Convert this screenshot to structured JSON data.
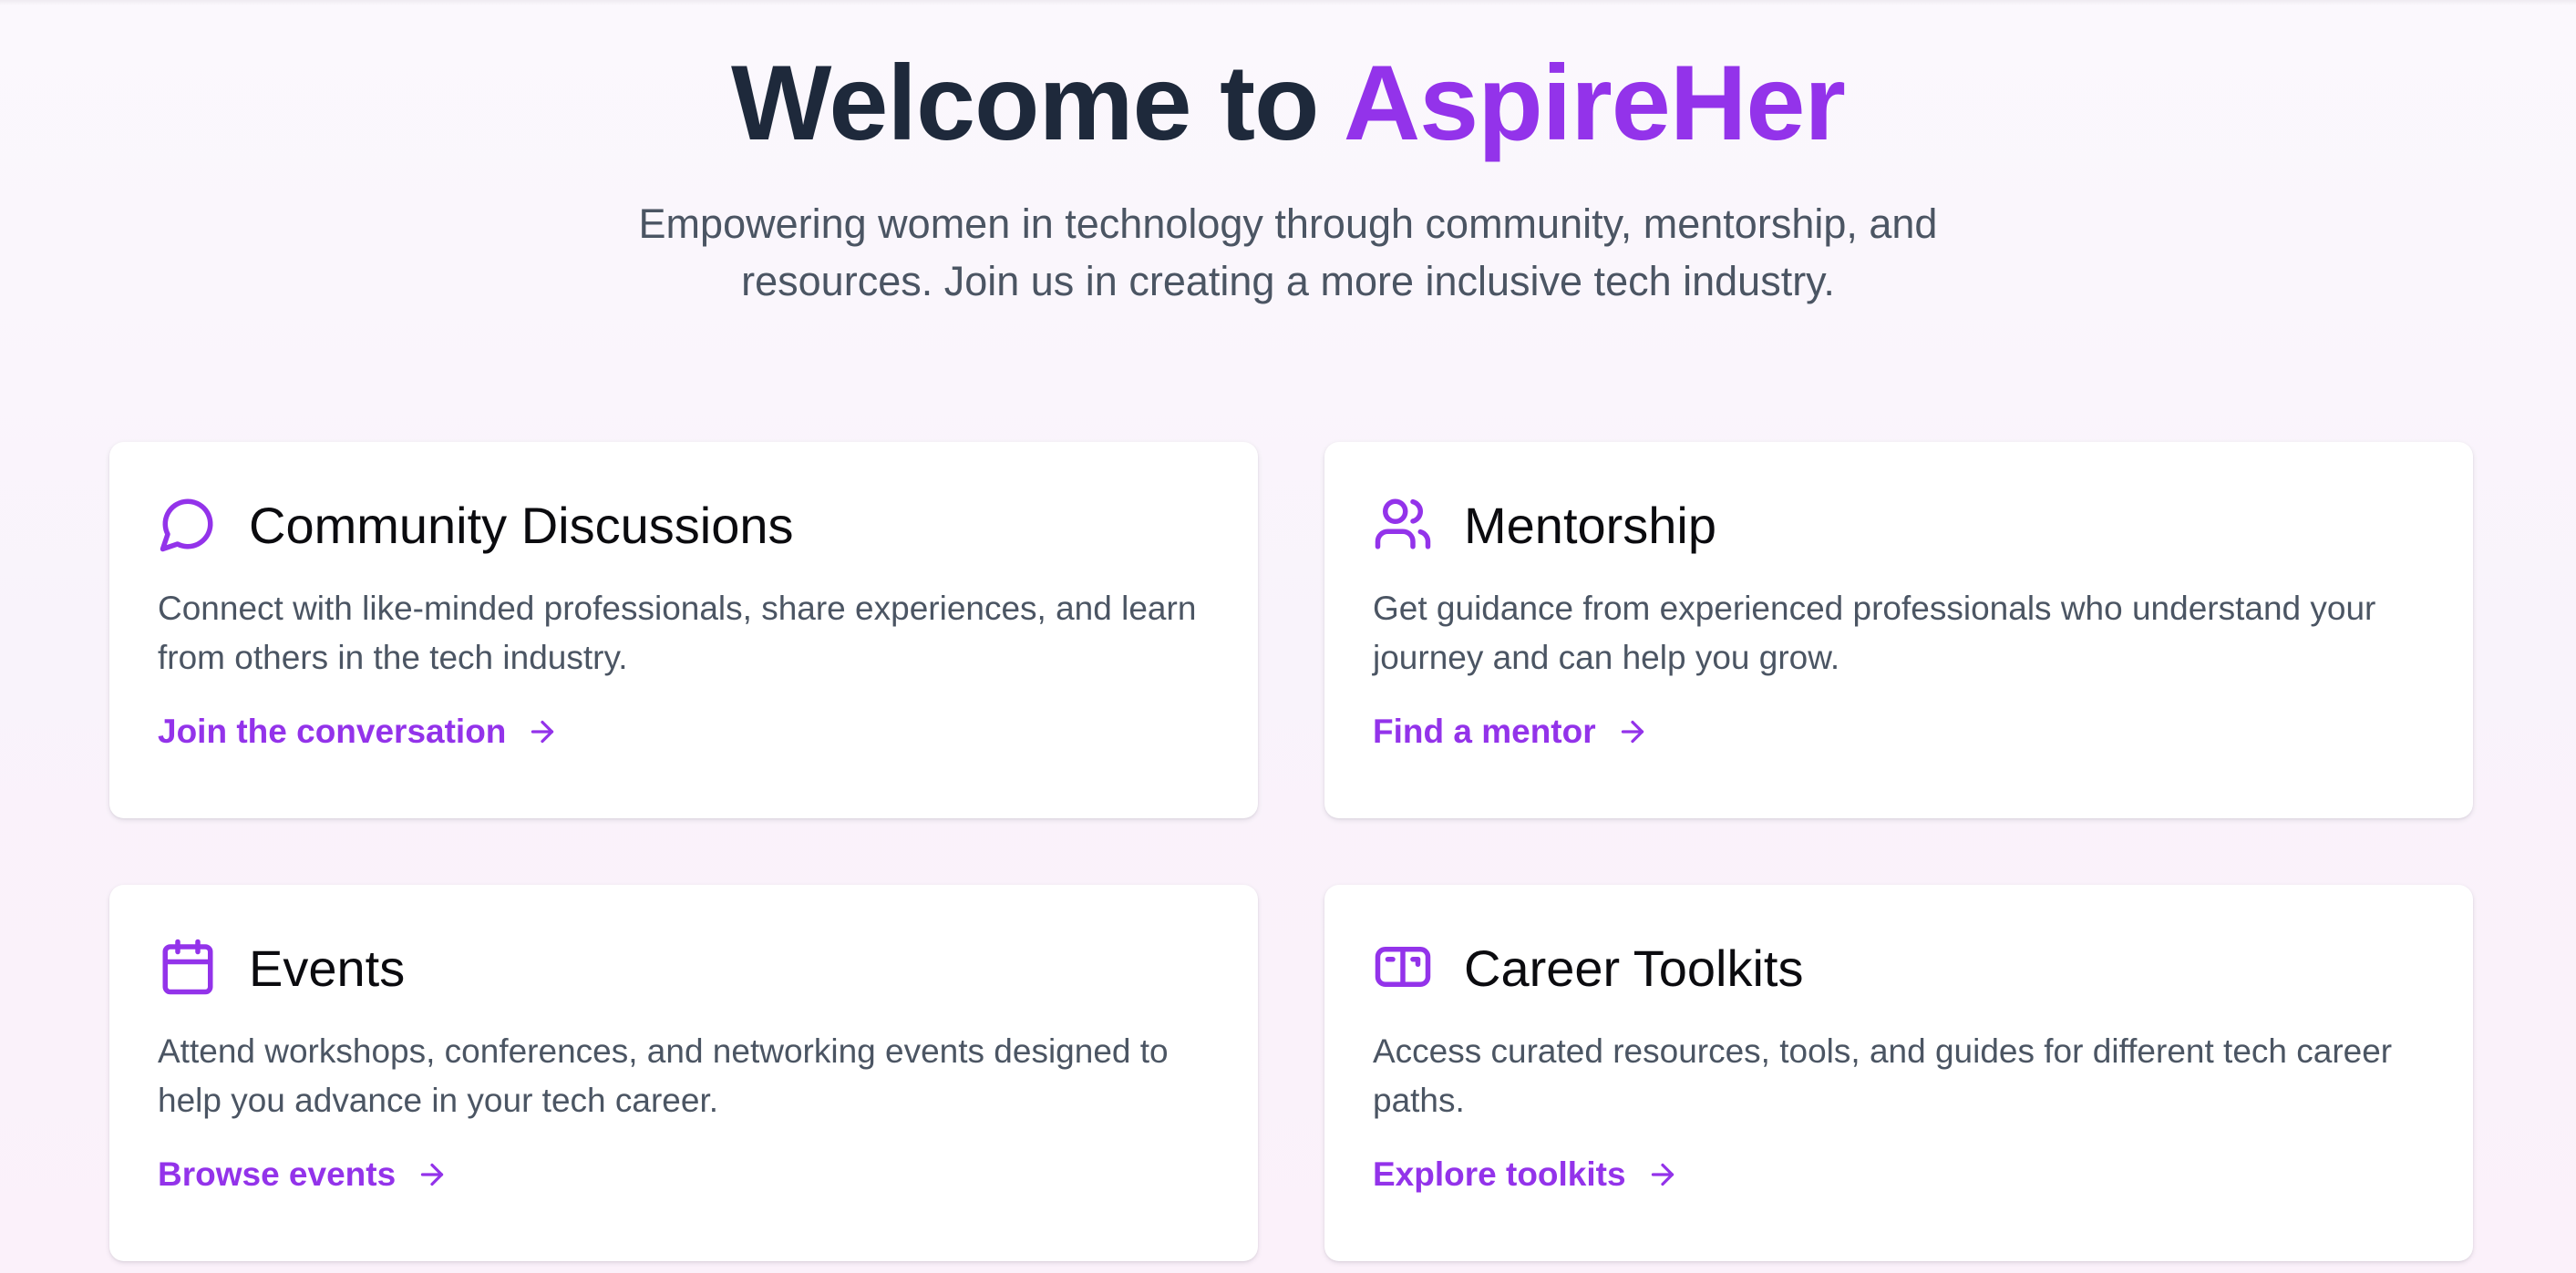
{
  "hero": {
    "title_prefix": "Welcome to ",
    "title_brand": "AspireHer",
    "subtitle": "Empowering women in technology through community, mentorship, and resources. Join us in creating a more inclusive tech industry."
  },
  "cards": [
    {
      "icon": "chat-bubble-icon",
      "title": "Community Discussions",
      "description": "Connect with like-minded professionals, share experiences, and learn from others in the tech industry.",
      "link": "Join the conversation"
    },
    {
      "icon": "users-icon",
      "title": "Mentorship",
      "description": "Get guidance from experienced professionals who understand your journey and can help you grow.",
      "link": "Find a mentor"
    },
    {
      "icon": "calendar-icon",
      "title": "Events",
      "description": "Attend workshops, conferences, and networking events designed to help you advance in your tech career.",
      "link": "Browse events"
    },
    {
      "icon": "toolkit-icon",
      "title": "Career Toolkits",
      "description": "Access curated resources, tools, and guides for different tech career paths.",
      "link": "Explore toolkits"
    }
  ],
  "colors": {
    "accent": "#9333ea",
    "heading": "#1e293b",
    "body_text": "#4b5563",
    "card_background": "#ffffff"
  }
}
